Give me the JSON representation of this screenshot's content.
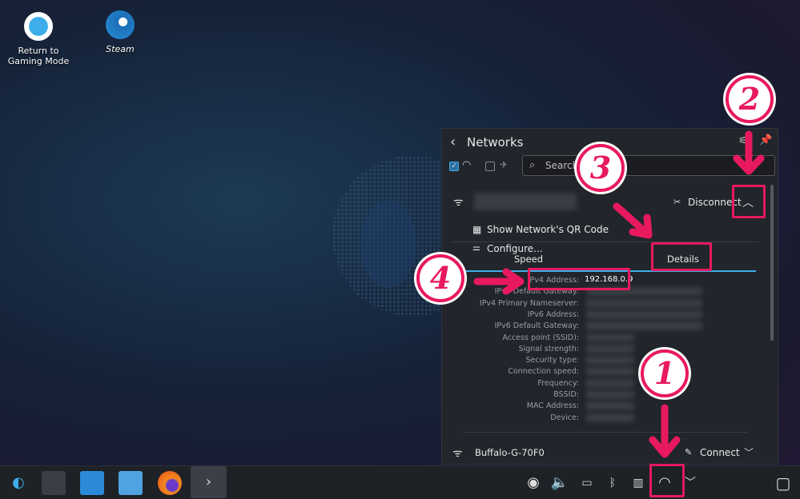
{
  "desktop": {
    "icons": [
      {
        "label_line1": "Return to",
        "label_line2": "Gaming Mode"
      },
      {
        "label": "Steam"
      }
    ]
  },
  "panel": {
    "title": "Networks",
    "search_placeholder": "Search...",
    "wifi_enabled": true,
    "airplane_mode": false,
    "connected": {
      "action": "Disconnect",
      "menu": [
        "Show Network's QR Code",
        "Configure..."
      ],
      "tabs": [
        "Speed",
        "Details"
      ],
      "active_tab": "Details",
      "details": [
        {
          "label": "IPv4 Address:",
          "value": "192.168.0.9"
        },
        {
          "label": "IPv4 Default Gateway:"
        },
        {
          "label": "IPv4 Primary Nameserver:"
        },
        {
          "label": "IPv6 Address:"
        },
        {
          "label": "IPv6 Default Gateway:"
        },
        {
          "label": "Access point (SSID):"
        },
        {
          "label": "Signal strength:"
        },
        {
          "label": "Security type:"
        },
        {
          "label": "Connection speed:"
        },
        {
          "label": "Frequency:"
        },
        {
          "label": "BSSID:"
        },
        {
          "label": "MAC Address:"
        },
        {
          "label": "Device:"
        }
      ]
    },
    "other": {
      "name": "Buffalo-G-70F0",
      "action": "Connect"
    }
  },
  "annotations": [
    "1",
    "2",
    "3",
    "4"
  ],
  "colors": {
    "accent": "#3daee9",
    "annotation": "#e8195f"
  }
}
